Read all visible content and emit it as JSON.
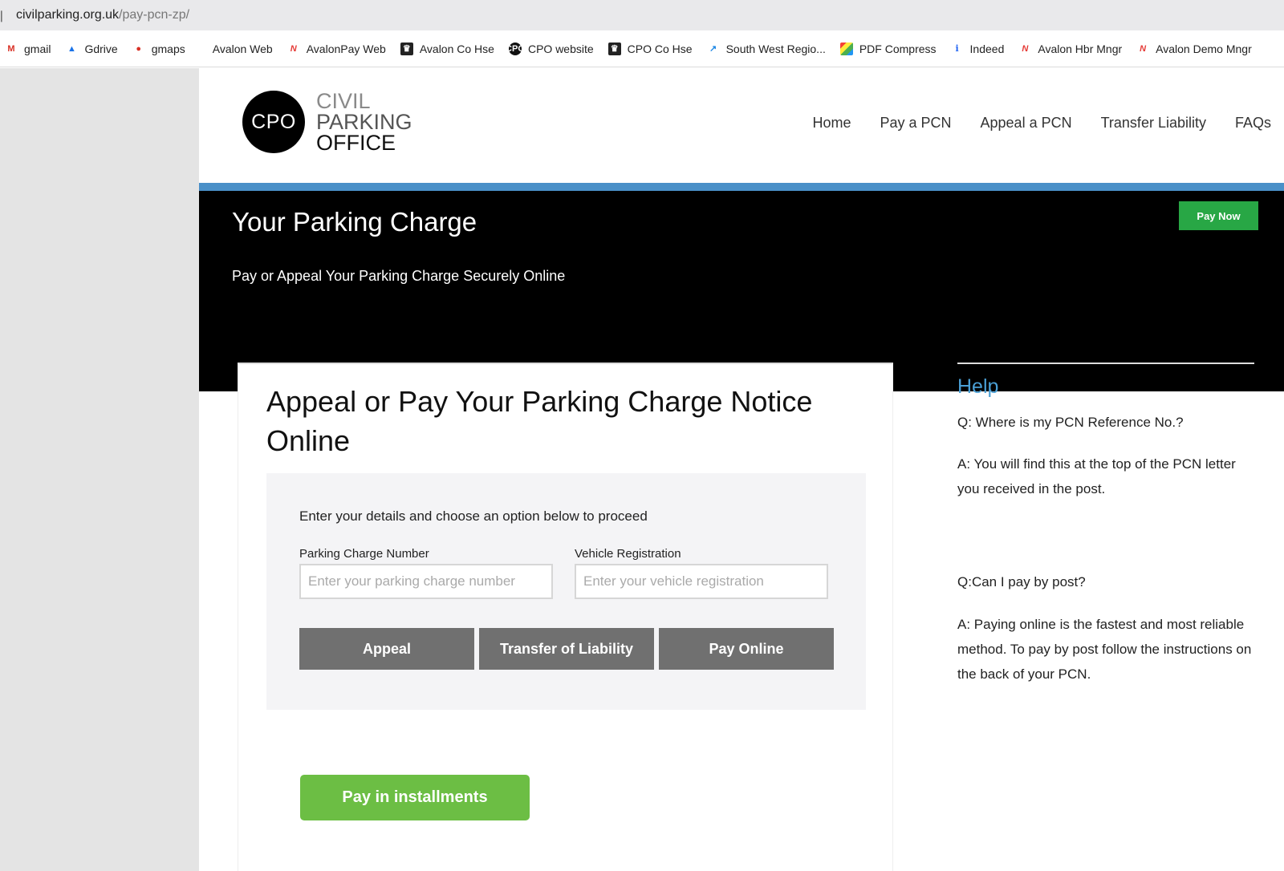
{
  "browser": {
    "url_host": "civilparking.org.uk",
    "url_path": "/pay-pcn-zp/",
    "bookmarks": [
      {
        "label": "gmail",
        "icon": "gmail-icon"
      },
      {
        "label": "Gdrive",
        "icon": "gdrive-icon"
      },
      {
        "label": "gmaps",
        "icon": "gmaps-icon"
      },
      {
        "label": "Avalon Web",
        "icon": ""
      },
      {
        "label": "AvalonPay Web",
        "icon": "avalon-icon"
      },
      {
        "label": "Avalon Co Hse",
        "icon": "crown-icon"
      },
      {
        "label": "CPO website",
        "icon": "cpo-icon"
      },
      {
        "label": "CPO Co Hse",
        "icon": "crown-icon"
      },
      {
        "label": "South West Regio...",
        "icon": "chart-icon"
      },
      {
        "label": "PDF Compress",
        "icon": "pdf-icon"
      },
      {
        "label": "Indeed",
        "icon": "indeed-icon"
      },
      {
        "label": "Avalon Hbr Mngr",
        "icon": "avalon-icon"
      },
      {
        "label": "Avalon Demo Mngr",
        "icon": "avalon-icon"
      }
    ]
  },
  "header": {
    "logo_mark": "CPO",
    "logo_line1": "CIVIL",
    "logo_line2": "PARKING",
    "logo_line3": "OFFICE",
    "nav": [
      "Home",
      "Pay a PCN",
      "Appeal a PCN",
      "Transfer Liability",
      "FAQs"
    ]
  },
  "hero": {
    "title": "Your Parking Charge",
    "subtitle": "Pay or Appeal Your Parking Charge Securely Online",
    "pay_now": "Pay Now"
  },
  "form": {
    "title": "Appeal or Pay Your Parking Charge Notice Online",
    "intro": "Enter your details and choose an option below to proceed",
    "pcn_label": "Parking Charge Number",
    "pcn_placeholder": "Enter your parking charge number",
    "pcn_value": "",
    "vrn_label": "Vehicle Registration",
    "vrn_placeholder": "Enter your vehicle registration",
    "vrn_value": "",
    "appeal": "Appeal",
    "transfer": "Transfer of Liability",
    "pay_online": "Pay Online",
    "installments": "Pay in installments"
  },
  "help": {
    "title": "Help",
    "q1": "Q: Where is my PCN Reference No.?",
    "a1": "A: You will find this at the top of the PCN letter you received in the post.",
    "q2": "Q:Can I pay by post?",
    "a2": "A: Paying online is the fastest and most reliable method. To pay by post follow the instructions on the back of your PCN."
  },
  "colors": {
    "accent_blue": "#4a90c8",
    "help_blue": "#4a9fd5",
    "pay_now_green": "#28a745",
    "installments_green": "#6cbe44",
    "button_grey": "#707070"
  }
}
